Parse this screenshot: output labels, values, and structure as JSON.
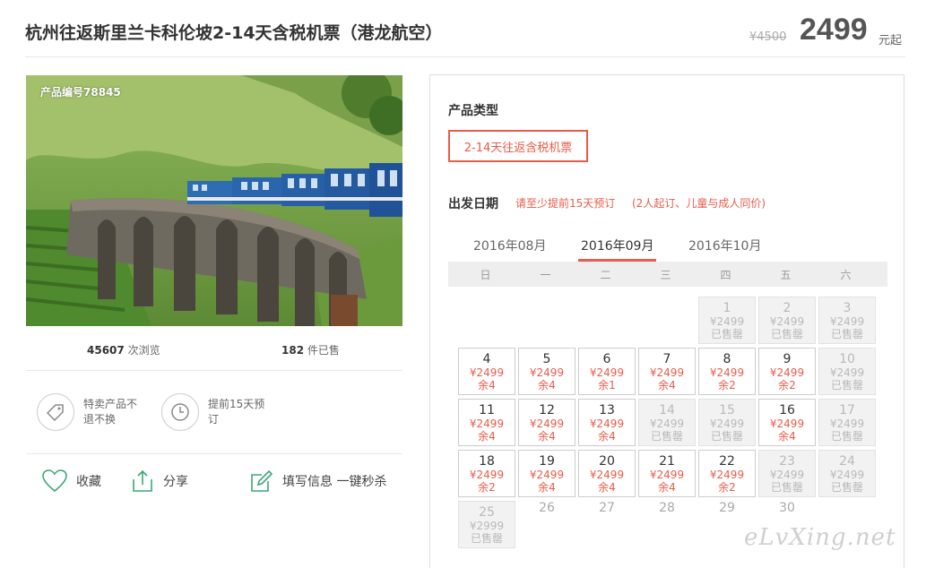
{
  "header": {
    "title": "杭州往返斯里兰卡科伦坡2-14天含税机票（港龙航空）",
    "old_price": "¥4500",
    "price": "2499",
    "price_suffix": "元起"
  },
  "photo": {
    "product_code": "产品编号78845"
  },
  "stats": {
    "views_count": "45607",
    "views_label": "次浏览",
    "sold_count": "182",
    "sold_label": "件已售"
  },
  "features": [
    {
      "icon": "tag-icon",
      "text": "特卖产品不退不换"
    },
    {
      "icon": "clock-icon",
      "text": "提前15天预订"
    }
  ],
  "actions": {
    "favorite": "收藏",
    "share": "分享",
    "fill_info": "填写信息 一键秒杀"
  },
  "booking": {
    "type_label": "产品类型",
    "type_option": "2-14天往返含税机票",
    "date_label": "出发日期",
    "note1": "请至少提前15天预订",
    "note2": "(2人起订、儿童与成人同价)"
  },
  "months": [
    {
      "label": "2016年08月",
      "active": false
    },
    {
      "label": "2016年09月",
      "active": true
    },
    {
      "label": "2016年10月",
      "active": false
    }
  ],
  "weekdays": [
    "日",
    "一",
    "二",
    "三",
    "四",
    "五",
    "六"
  ],
  "calendar": [
    [
      null,
      null,
      null,
      null,
      {
        "day": "1",
        "price": "¥2499",
        "status": "已售罄",
        "sold": true
      },
      {
        "day": "2",
        "price": "¥2499",
        "status": "已售罄",
        "sold": true
      },
      {
        "day": "3",
        "price": "¥2499",
        "status": "已售罄",
        "sold": true
      }
    ],
    [
      {
        "day": "4",
        "price": "¥2499",
        "status": "余4",
        "sold": false
      },
      {
        "day": "5",
        "price": "¥2499",
        "status": "余4",
        "sold": false
      },
      {
        "day": "6",
        "price": "¥2499",
        "status": "余1",
        "sold": false
      },
      {
        "day": "7",
        "price": "¥2499",
        "status": "余4",
        "sold": false
      },
      {
        "day": "8",
        "price": "¥2499",
        "status": "余2",
        "sold": false
      },
      {
        "day": "9",
        "price": "¥2499",
        "status": "余2",
        "sold": false
      },
      {
        "day": "10",
        "price": "¥2499",
        "status": "已售罄",
        "sold": true
      }
    ],
    [
      {
        "day": "11",
        "price": "¥2499",
        "status": "余4",
        "sold": false
      },
      {
        "day": "12",
        "price": "¥2499",
        "status": "余4",
        "sold": false
      },
      {
        "day": "13",
        "price": "¥2499",
        "status": "余4",
        "sold": false
      },
      {
        "day": "14",
        "price": "¥2499",
        "status": "已售罄",
        "sold": true
      },
      {
        "day": "15",
        "price": "¥2499",
        "status": "已售罄",
        "sold": true
      },
      {
        "day": "16",
        "price": "¥2499",
        "status": "余4",
        "sold": false
      },
      {
        "day": "17",
        "price": "¥2499",
        "status": "已售罄",
        "sold": true
      }
    ],
    [
      {
        "day": "18",
        "price": "¥2499",
        "status": "余2",
        "sold": false
      },
      {
        "day": "19",
        "price": "¥2499",
        "status": "余4",
        "sold": false
      },
      {
        "day": "20",
        "price": "¥2499",
        "status": "余4",
        "sold": false
      },
      {
        "day": "21",
        "price": "¥2499",
        "status": "余4",
        "sold": false
      },
      {
        "day": "22",
        "price": "¥2499",
        "status": "余2",
        "sold": false
      },
      {
        "day": "23",
        "price": "¥2499",
        "status": "已售罄",
        "sold": true
      },
      {
        "day": "24",
        "price": "¥2499",
        "status": "已售罄",
        "sold": true
      }
    ],
    [
      {
        "day": "25",
        "price": "¥2999",
        "status": "已售罄",
        "sold": true
      },
      {
        "day": "26"
      },
      {
        "day": "27"
      },
      {
        "day": "28"
      },
      {
        "day": "29"
      },
      {
        "day": "30"
      },
      null
    ]
  ],
  "watermark": "eLvXing.net",
  "colors": {
    "accent": "#e85c4a",
    "icon_green": "#3aa877",
    "sold_bg": "#f2f2f2"
  }
}
